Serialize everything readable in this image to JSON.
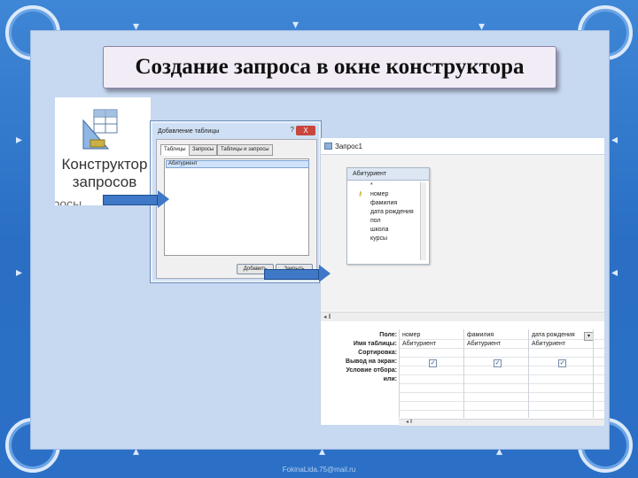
{
  "slide": {
    "title": "Создание запроса в окне конструктора",
    "footer": "FokinaLida.75@mail.ru"
  },
  "ribbon_button": {
    "label_line1": "Конструктор",
    "label_line2": "запросов",
    "partial_below": "просы",
    "icon": "query-designer-icon"
  },
  "add_table_dialog": {
    "title": "Добавление таблицы",
    "help": "?",
    "close": "X",
    "tabs": [
      "Таблицы",
      "Запросы",
      "Таблицы и запросы"
    ],
    "selected_item": "Абитуриент",
    "add_button": "Добавить",
    "close_button": "Закрыть"
  },
  "query_window": {
    "title": "Запрос1",
    "table_box": {
      "name": "Абитуриент",
      "fields": [
        "*",
        "номер",
        "фамилия",
        "дата рождения",
        "пол",
        "школа",
        "курсы"
      ],
      "key_field_icon": "key-icon"
    },
    "grid": {
      "row_labels": [
        "Поле:",
        "Имя таблицы:",
        "Сортировка:",
        "Вывод на экран:",
        "Условие отбора:",
        "или:"
      ],
      "columns": [
        {
          "field": "номер",
          "table": "Абитуриент",
          "show": true
        },
        {
          "field": "фамилия",
          "table": "Абитуриент",
          "show": true
        },
        {
          "field": "дата рождения",
          "table": "Абитуриент",
          "show": true
        }
      ],
      "checkmark": "✓",
      "dropdown": "▾"
    },
    "scroll_left": "◂ ‖"
  },
  "colors": {
    "border_blue": "#2a6fc4",
    "inner_bg": "#c7d8f1",
    "arrow_blue": "#3e78c6"
  }
}
